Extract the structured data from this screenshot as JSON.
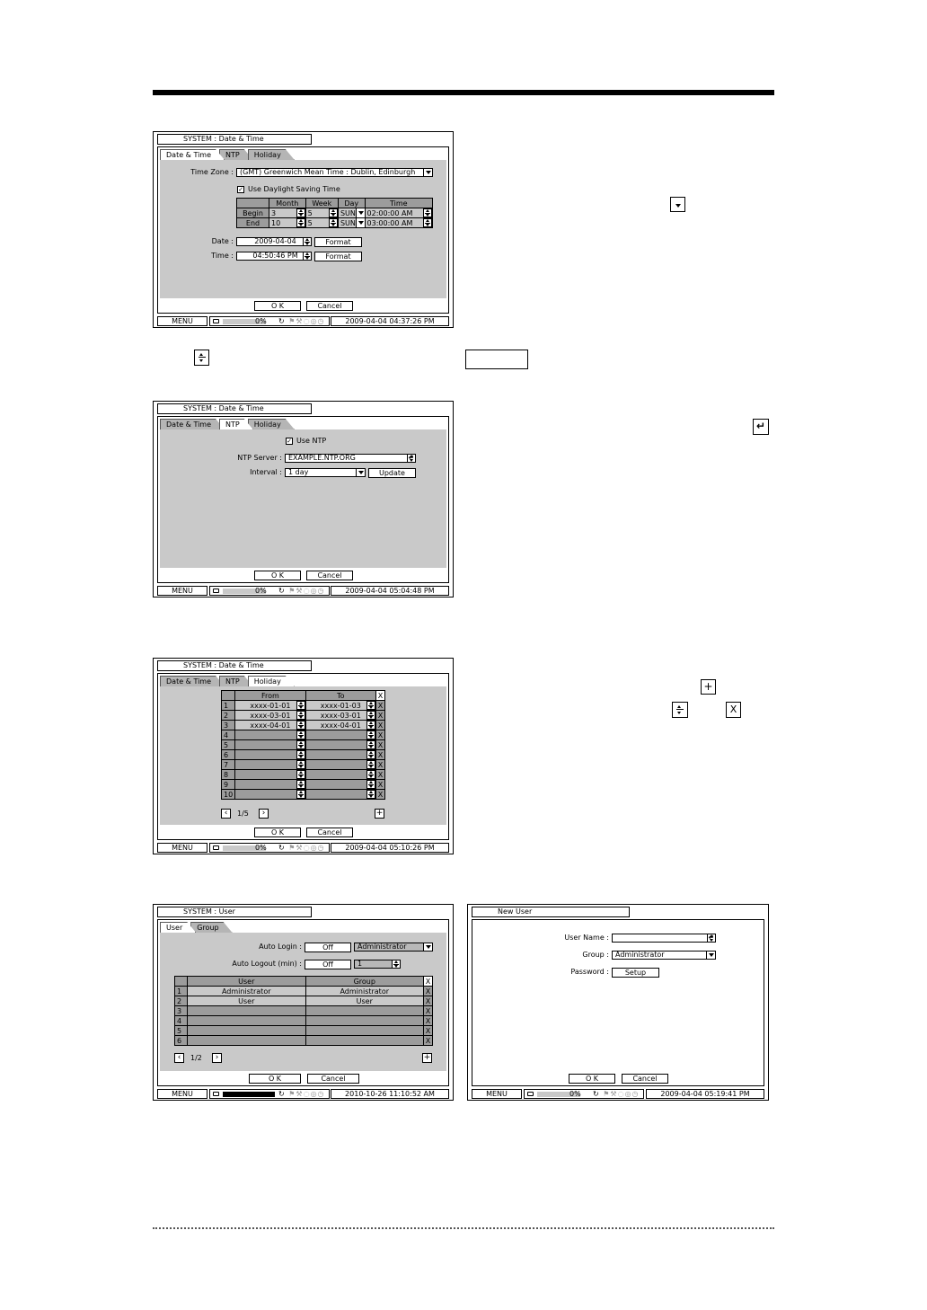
{
  "common": {
    "ok": "O K",
    "cancel": "Cancel",
    "menu": "MENU",
    "hdd_pct": "0%"
  },
  "panel1": {
    "title": "SYSTEM : Date & Time",
    "tabs": [
      "Date & Time",
      "NTP",
      "Holiday"
    ],
    "time_zone_label": "Time Zone :",
    "time_zone_value": "(GMT) Greenwich Mean Time : Dublin, Edinburgh",
    "dst_label": "Use Daylight Saving Time",
    "dst_headers": [
      "Month",
      "Week",
      "Day",
      "Time"
    ],
    "dst_rows": [
      {
        "label": "Begin",
        "month": "3",
        "week": "5",
        "day": "SUN",
        "time": "02:00:00 AM"
      },
      {
        "label": "End",
        "month": "10",
        "week": "5",
        "day": "SUN",
        "time": "03:00:00 AM"
      }
    ],
    "date_label": "Date :",
    "date_value": "2009-04-04",
    "time_label": "Time :",
    "time_value": "04:50:46 PM",
    "format": "Format",
    "status_datetime": "2009-04-04  04:37:26 PM"
  },
  "panel2": {
    "title": "SYSTEM : Date & Time",
    "tabs": [
      "Date & Time",
      "NTP",
      "Holiday"
    ],
    "use_ntp": "Use NTP",
    "server_label": "NTP Server :",
    "server_value": "EXAMPLE.NTP.ORG",
    "interval_label": "Interval :",
    "interval_value": "1 day",
    "update": "Update",
    "status_datetime": "2009-04-04  05:04:48 PM"
  },
  "panel3": {
    "title": "SYSTEM : Date & Time",
    "tabs": [
      "Date & Time",
      "NTP",
      "Holiday"
    ],
    "headers": [
      "From",
      "To",
      "X"
    ],
    "rows": [
      {
        "n": "1",
        "from": "xxxx-01-01",
        "to": "xxxx-01-03"
      },
      {
        "n": "2",
        "from": "xxxx-03-01",
        "to": "xxxx-03-01"
      },
      {
        "n": "3",
        "from": "xxxx-04-01",
        "to": "xxxx-04-01"
      },
      {
        "n": "4",
        "from": "",
        "to": ""
      },
      {
        "n": "5",
        "from": "",
        "to": ""
      },
      {
        "n": "6",
        "from": "",
        "to": ""
      },
      {
        "n": "7",
        "from": "",
        "to": ""
      },
      {
        "n": "8",
        "from": "",
        "to": ""
      },
      {
        "n": "9",
        "from": "",
        "to": ""
      },
      {
        "n": "10",
        "from": "",
        "to": ""
      }
    ],
    "x": "X",
    "page": "1/5",
    "status_datetime": "2009-04-04  05:10:26 PM"
  },
  "panel4": {
    "title": "SYSTEM : User",
    "tabs": [
      "User",
      "Group"
    ],
    "auto_login_label": "Auto Login :",
    "auto_login_value": "Off",
    "auto_login_user": "Administrator",
    "auto_logout_label": "Auto Logout (min) :",
    "auto_logout_value": "Off",
    "auto_logout_min": "1",
    "headers": [
      "User",
      "Group",
      "X"
    ],
    "rows": [
      {
        "n": "1",
        "user": "Administrator",
        "group": "Administrator"
      },
      {
        "n": "2",
        "user": "User",
        "group": "User"
      },
      {
        "n": "3",
        "user": "",
        "group": ""
      },
      {
        "n": "4",
        "user": "",
        "group": ""
      },
      {
        "n": "5",
        "user": "",
        "group": ""
      },
      {
        "n": "6",
        "user": "",
        "group": ""
      }
    ],
    "page": "1/2",
    "status_datetime": "2010-10-26 11:10:52 AM"
  },
  "panel5": {
    "title": "New User",
    "user_name_label": "User Name :",
    "group_label": "Group :",
    "group_value": "Administrator",
    "password_label": "Password :",
    "setup": "Setup",
    "status_datetime": "2009-04-04  05:19:41 PM"
  }
}
